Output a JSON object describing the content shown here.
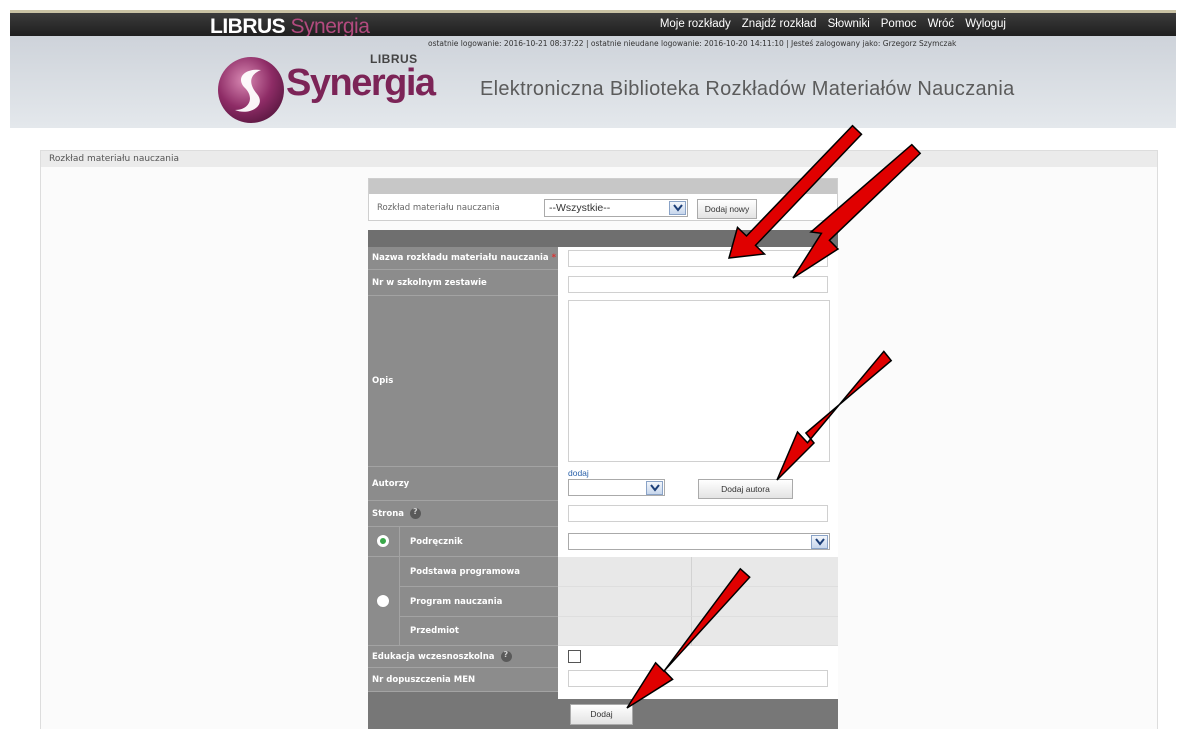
{
  "brand": {
    "word1": "LIBRUS",
    "word2": "Synergia"
  },
  "top_nav": [
    "Moje rozkłady",
    "Znajdź rozkład",
    "Słowniki",
    "Pomoc",
    "Wróć",
    "Wyloguj"
  ],
  "header": {
    "login_info": "ostatnie logowanie: 2016-10-21 08:37:22  |  ostatnie nieudane logowanie: 2016-10-20 14:11:10  |  Jesteś zalogowany jako: Grzegorz Szymczak",
    "logo_small": "LIBRUS",
    "logo_word": "Synergia",
    "app_title": "Elektroniczna Biblioteka Rozkładów Materiałów Nauczania"
  },
  "panel": {
    "title": "Rozkład materiału nauczania"
  },
  "filter": {
    "label": "Rozkład materiału nauczania",
    "select_value": "--Wszystkie--",
    "add_new_label": "Dodaj nowy"
  },
  "form": {
    "name_label": "Nazwa rozkładu materiału nauczania",
    "required_mark": "*",
    "school_set_label": "Nr w szkolnym zestawie",
    "description_label": "Opis",
    "authors_label": "Autorzy",
    "authors_add_link": "dodaj",
    "add_author_label": "Dodaj autora",
    "page_label": "Strona",
    "textbook_label": "Podręcznik",
    "core_curriculum_label": "Podstawa programowa",
    "curriculum_label": "Program nauczania",
    "subject_label": "Przedmiot",
    "early_edu_label": "Edukacja wczesnoszkolna",
    "men_number_label": "Nr dopuszczenia MEN",
    "submit_label": "Dodaj"
  },
  "colors": {
    "accent": "#7c2457",
    "arrow": "#e00000",
    "radio_on": "#3aa84a"
  }
}
